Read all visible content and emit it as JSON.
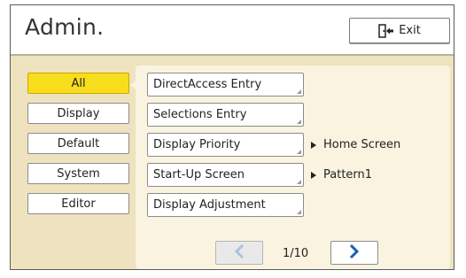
{
  "header": {
    "title": "Admin.",
    "exit_label": "Exit"
  },
  "sidebar": {
    "items": [
      {
        "label": "All",
        "active": true
      },
      {
        "label": "Display",
        "active": false
      },
      {
        "label": "Default",
        "active": false
      },
      {
        "label": "System",
        "active": false
      },
      {
        "label": "Editor",
        "active": false
      }
    ]
  },
  "main": {
    "items": [
      {
        "label": "DirectAccess Entry",
        "value": ""
      },
      {
        "label": "Selections Entry",
        "value": ""
      },
      {
        "label": "Display Priority",
        "value": "Home Screen"
      },
      {
        "label": "Start-Up Screen",
        "value": "Pattern1"
      },
      {
        "label": "Display Adjustment",
        "value": ""
      }
    ]
  },
  "pager": {
    "page_text": "1/10",
    "prev_enabled": false,
    "next_enabled": true
  },
  "colors": {
    "active_tab": "#f7dd1c",
    "panel_bg": "#efe3bf",
    "next_arrow": "#1a5fb4",
    "prev_arrow_disabled": "#a9c3df"
  },
  "icons": {
    "exit": "exit-door-icon",
    "prev": "chevron-left-icon",
    "next": "chevron-right-icon",
    "value_marker": "triangle-right-icon"
  }
}
